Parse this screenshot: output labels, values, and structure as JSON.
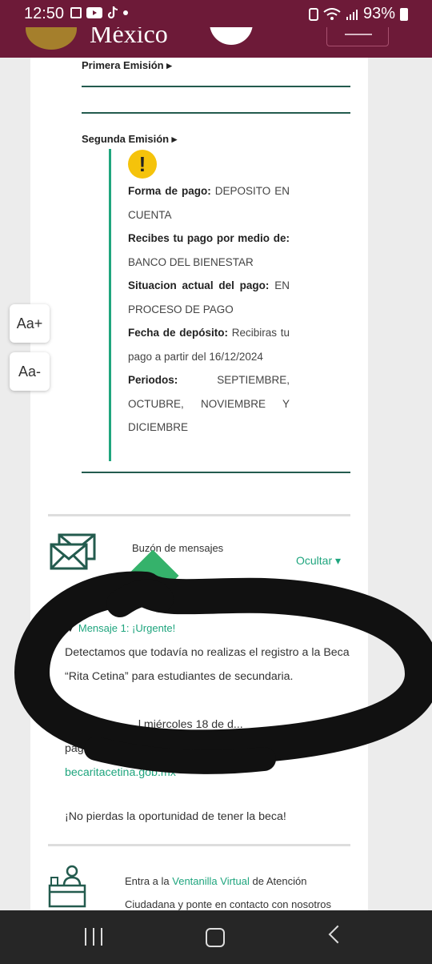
{
  "status_bar": {
    "time": "12:50",
    "battery": "93%",
    "icons": [
      "checkbox-icon",
      "youtube-icon",
      "tiktok-icon",
      "dot-icon",
      "nfc-icon",
      "wifi-icon",
      "signal-icon",
      "battery-icon"
    ]
  },
  "app_header": {
    "logo_text": "México",
    "menu_icon": "hamburger-icon"
  },
  "emisiones": {
    "primera_label": "Primera Emisión ▸",
    "segunda_label": "Segunda Emisión ▸"
  },
  "payment": {
    "warning_icon": "!",
    "forma_label": "Forma de pago:",
    "forma_value": "DEPOSITO EN CUENTA",
    "medio_label": "Recibes tu pago por medio de:",
    "medio_value": "BANCO DEL BIENESTAR",
    "situacion_label": "Situacion actual del pago:",
    "situacion_value": "EN PROCESO DE PAGO",
    "fecha_label": "Fecha de depósito:",
    "fecha_value": "Recibiras tu pago a partir del 16/12/2024",
    "periodos_label": "Periodos:",
    "periodos_value": "SEPTIEMBRE, OCTUBRE, NOVIEMBRE Y DICIEMBRE"
  },
  "text_size": {
    "increase": "Aa+",
    "decrease": "Aa-"
  },
  "mailbox": {
    "icon": "envelope-icon",
    "title": "Buzón de mensajes",
    "hide_label": "Ocultar ▾",
    "message_title": "Mensaje 1: ¡Urgente!",
    "message_body": "Detectamos que todavía no realizas el registro a la Beca “Rita Cetina” para estudiantes de secundaria.",
    "partial_line1": "...l miércoles 18 de d...",
    "partial_line2": "pag...",
    "link": "becaritacetina.gob.mx",
    "closing": "¡No pierdas la oportunidad de tener la beca!"
  },
  "ventanilla": {
    "icon": "service-desk-icon",
    "prefix": "Entra a la ",
    "link": "Ventanilla Virtual",
    "suffix": " de Atención Ciudadana y ponte en contacto con nosotros"
  },
  "colors": {
    "header": "#6d1a38",
    "accent_green": "#1fa57e",
    "dark_green": "#235b4e",
    "warning_yellow": "#f5c30b"
  }
}
